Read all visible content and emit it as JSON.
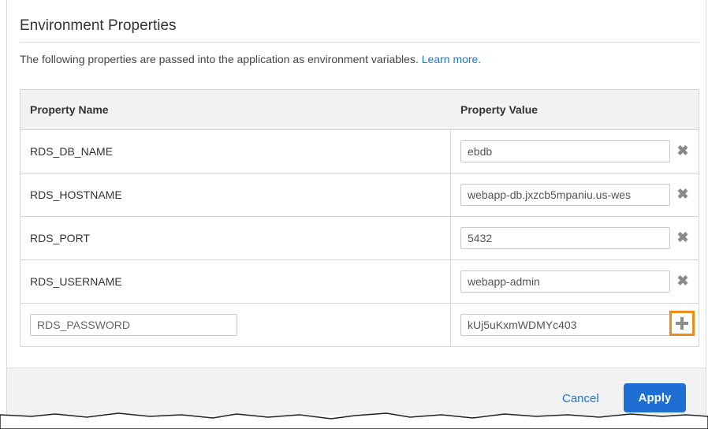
{
  "panel": {
    "title": "Environment Properties",
    "description": "The following properties are passed into the application as environment variables.",
    "learn_more": "Learn more."
  },
  "table": {
    "headers": {
      "name": "Property Name",
      "value": "Property Value"
    },
    "rows": [
      {
        "name": "RDS_DB_NAME",
        "value": "ebdb"
      },
      {
        "name": "RDS_HOSTNAME",
        "value": "webapp-db.jxzcb5mpaniu.us-wes"
      },
      {
        "name": "RDS_PORT",
        "value": "5432"
      },
      {
        "name": "RDS_USERNAME",
        "value": "webapp-admin"
      }
    ],
    "new_row": {
      "name_value": "RDS_PASSWORD",
      "value_value": "kUj5uKxmWDMYc403"
    }
  },
  "footer": {
    "cancel_label": "Cancel",
    "apply_label": "Apply"
  },
  "icons": {
    "remove": "close-x-icon",
    "add": "plus-icon"
  },
  "colors": {
    "link": "#1f75cb",
    "apply_bg": "#1f6ed4",
    "highlight": "#f08a18"
  }
}
